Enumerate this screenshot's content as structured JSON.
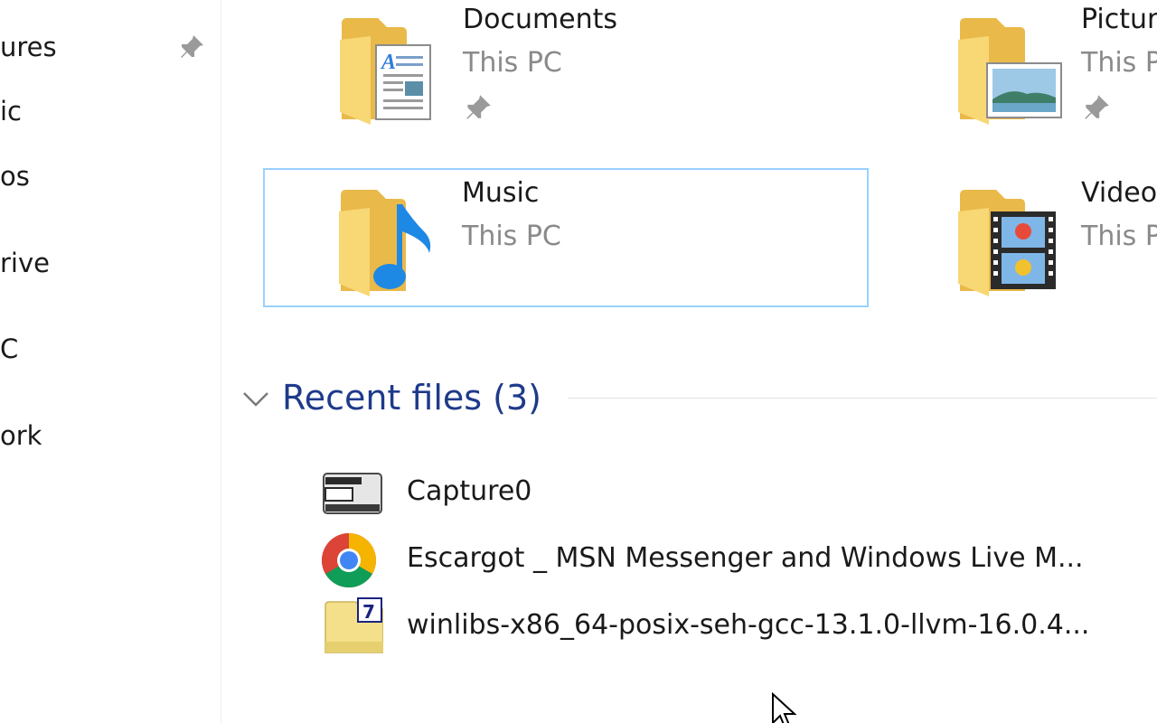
{
  "nav": {
    "items": [
      {
        "label": "ures"
      },
      {
        "label": "ic"
      },
      {
        "label": "os"
      },
      {
        "label": "rive"
      },
      {
        "label": "C"
      },
      {
        "label": "ork"
      }
    ],
    "pin_icon": "pin-icon"
  },
  "quick_access": {
    "folders": [
      {
        "name": "Documents",
        "location": "This PC",
        "icon": "documents-folder-icon",
        "pinned": true
      },
      {
        "name": "Pictur",
        "location": "This P",
        "icon": "pictures-folder-icon",
        "pinned": true
      },
      {
        "name": "Music",
        "location": "This PC",
        "icon": "music-folder-icon",
        "pinned": false,
        "selected": true
      },
      {
        "name": "Video",
        "location": "This P",
        "icon": "videos-folder-icon",
        "pinned": false
      }
    ]
  },
  "recent": {
    "title": "Recent files (3)",
    "files": [
      {
        "name": "Capture0",
        "icon": "capture-file-icon"
      },
      {
        "name": "Escargot _ MSN Messenger and Windows Live M...",
        "icon": "chrome-icon"
      },
      {
        "name": "winlibs-x86_64-posix-seh-gcc-13.1.0-llvm-16.0.4...",
        "icon": "7zip-archive-icon"
      }
    ]
  },
  "colors": {
    "section_title": "#1e3a8a",
    "selection_border": "#99d1ff",
    "secondary_text": "#8a8a8a",
    "folder_yellow": "#f8d775"
  }
}
